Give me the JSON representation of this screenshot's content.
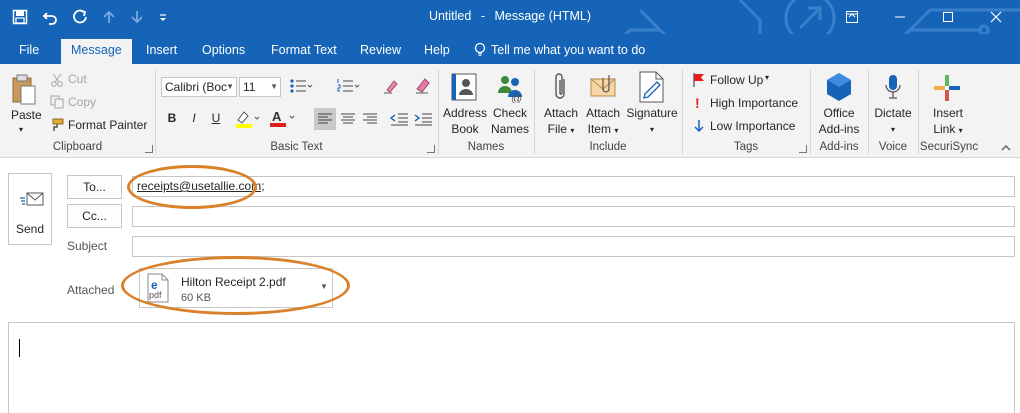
{
  "window": {
    "title_left": "Untitled",
    "title_sep": "-",
    "title_right": "Message (HTML)"
  },
  "tabs": [
    {
      "label": "File"
    },
    {
      "label": "Message"
    },
    {
      "label": "Insert"
    },
    {
      "label": "Options"
    },
    {
      "label": "Format Text"
    },
    {
      "label": "Review"
    },
    {
      "label": "Help"
    }
  ],
  "tell_me": "Tell me what you want to do",
  "ribbon": {
    "clipboard": {
      "label": "Clipboard",
      "paste": "Paste",
      "cut": "Cut",
      "copy": "Copy",
      "format_painter": "Format Painter"
    },
    "basic_text": {
      "label": "Basic Text",
      "font": "Calibri (Boc",
      "size": "11",
      "bold": "B",
      "italic": "I",
      "underline": "U"
    },
    "names": {
      "label": "Names",
      "address_book_1": "Address",
      "address_book_2": "Book",
      "check_names_1": "Check",
      "check_names_2": "Names"
    },
    "include": {
      "label": "Include",
      "attach_file_1": "Attach",
      "attach_file_2": "File",
      "attach_item_1": "Attach",
      "attach_item_2": "Item",
      "signature": "Signature"
    },
    "tags": {
      "label": "Tags",
      "follow_up": "Follow Up",
      "high_importance": "High Importance",
      "low_importance": "Low Importance"
    },
    "addins": {
      "label": "Add-ins",
      "office_1": "Office",
      "office_2": "Add-ins"
    },
    "voice": {
      "label": "Voice",
      "dictate": "Dictate"
    },
    "securisync": {
      "label": "SecuriSync",
      "insert_1": "Insert",
      "insert_2": "Link"
    }
  },
  "compose": {
    "send": "Send",
    "to_button": "To...",
    "cc_button": "Cc...",
    "subject_label": "Subject",
    "attached_label": "Attached",
    "to_value": "receipts@usetallie.com;",
    "cc_value": "",
    "subject_value": "",
    "attachment": {
      "name": "Hilton Receipt 2.pdf",
      "size": "60 KB",
      "ext": "pdf"
    }
  },
  "colors": {
    "titlebar": "#1564b7",
    "ribbon_bg": "#f3f3f3",
    "highlight": "#d9822b"
  }
}
